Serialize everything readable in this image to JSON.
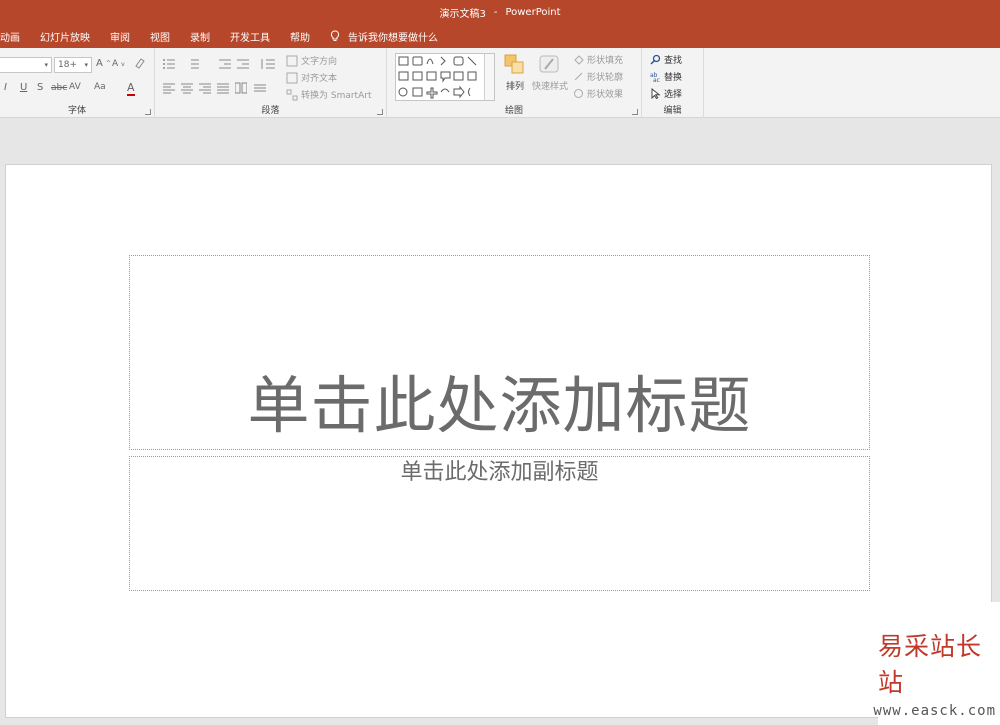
{
  "window": {
    "doc_title": "演示文稿3",
    "separator": "-",
    "app_name": "PowerPoint"
  },
  "tabs": [
    "动画",
    "幻灯片放映",
    "审阅",
    "视图",
    "录制",
    "开发工具",
    "帮助"
  ],
  "tell_me": "告诉我你想要做什么",
  "ribbon": {
    "font": {
      "size_value": "18+",
      "group_label": "字体",
      "grow": "A",
      "shrink": "A",
      "italic": "I",
      "underline": "U",
      "shadow": "S",
      "strike": "abc",
      "spacing": "AV",
      "case": "Aa",
      "color": "A"
    },
    "paragraph": {
      "text_direction": "文字方向",
      "align_text": "对齐文本",
      "smartart": "转换为 SmartArt",
      "group_label": "段落"
    },
    "drawing": {
      "arrange": "排列",
      "quick_styles": "快速样式",
      "shape_fill": "形状填充",
      "shape_outline": "形状轮廓",
      "shape_effects": "形状效果",
      "group_label": "绘图"
    },
    "editing": {
      "find": "查找",
      "replace": "替换",
      "select": "选择",
      "group_label": "编辑"
    }
  },
  "slide": {
    "title_placeholder": "单击此处添加标题",
    "subtitle_placeholder": "单击此处添加副标题"
  },
  "watermark": {
    "brand": "易采站长站",
    "url": "www.easck.com"
  },
  "colors": {
    "accent": "#b7472a"
  }
}
